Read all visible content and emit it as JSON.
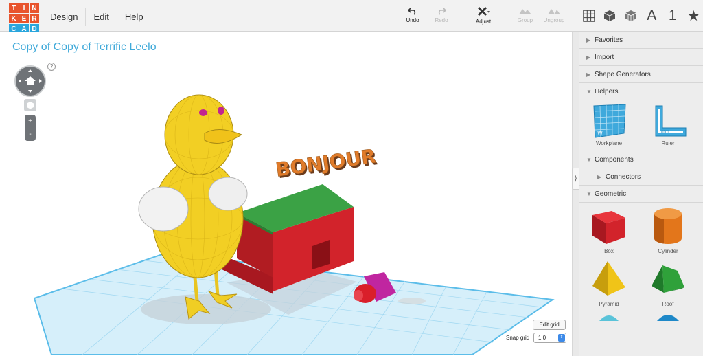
{
  "logo": {
    "letters": [
      "T",
      "I",
      "N",
      "K",
      "E",
      "R",
      "C",
      "A",
      "D"
    ],
    "colors": [
      "#e8542d",
      "#e8542d",
      "#e8542d",
      "#e8542d",
      "#e8542d",
      "#e8542d",
      "#2aa6dd",
      "#2aa6dd",
      "#2aa6dd"
    ]
  },
  "menu": {
    "items": [
      "Design",
      "Edit",
      "Help"
    ]
  },
  "toolbar": {
    "undo": "Undo",
    "redo": "Redo",
    "adjust": "Adjust",
    "group": "Group",
    "ungroup": "Ungroup"
  },
  "view_toolbar": {
    "icons": [
      "grid-view-icon",
      "box-view-icon",
      "shaded-box-icon",
      "text-icon",
      "number-icon",
      "star-icon"
    ],
    "text_label": "A",
    "number_label": "1",
    "star_label": "★"
  },
  "workplane": {
    "design_title": "Copy of Copy of Terrific Leelo",
    "help": "?",
    "zoom_in": "+",
    "zoom_out": "-",
    "scene_text": "BONJOUR",
    "edit_grid": "Edit grid",
    "snap_grid_label": "Snap grid",
    "snap_grid_value": "1.0"
  },
  "panel": {
    "sections": {
      "favorites": "Favorites",
      "import": "Import",
      "shape_generators": "Shape Generators",
      "helpers": "Helpers",
      "components": "Components",
      "connectors": "Connectors",
      "geometric": "Geometric"
    },
    "helpers": [
      "Workplane",
      "Ruler"
    ],
    "geometric": [
      "Box",
      "Cylinder",
      "Pyramid",
      "Roof"
    ],
    "colors": {
      "box": "#d9222a",
      "cylinder": "#e3761b",
      "pyramid": "#f0c418",
      "roof": "#2fa13a",
      "grid_blue": "#44b1e4",
      "accent": "#3fa9d9"
    }
  }
}
